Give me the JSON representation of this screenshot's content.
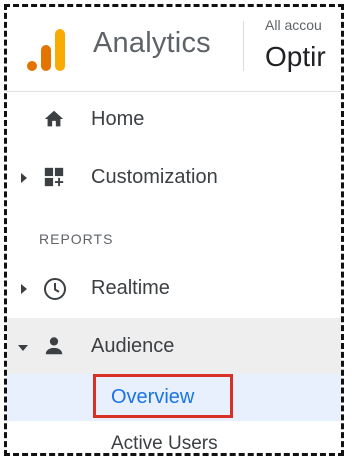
{
  "header": {
    "app_title": "Analytics",
    "account_label": "All accou",
    "property_name": "Optir"
  },
  "nav": {
    "home": {
      "label": "Home",
      "icon": "home-icon"
    },
    "customization": {
      "label": "Customization",
      "icon": "dashboard-plus-icon"
    },
    "section_header": "REPORTS",
    "realtime": {
      "label": "Realtime",
      "icon": "clock-icon"
    },
    "audience": {
      "label": "Audience",
      "icon": "person-icon",
      "expanded": true
    },
    "audience_items": [
      {
        "label": "Overview",
        "selected": true
      },
      {
        "label": "Active Users"
      }
    ]
  },
  "colors": {
    "logo_dark": "#e37400",
    "logo_light": "#f9ab00",
    "selected_text": "#1a73e8",
    "highlight_box": "#d93025",
    "selected_bg": "#e8f0fe"
  }
}
